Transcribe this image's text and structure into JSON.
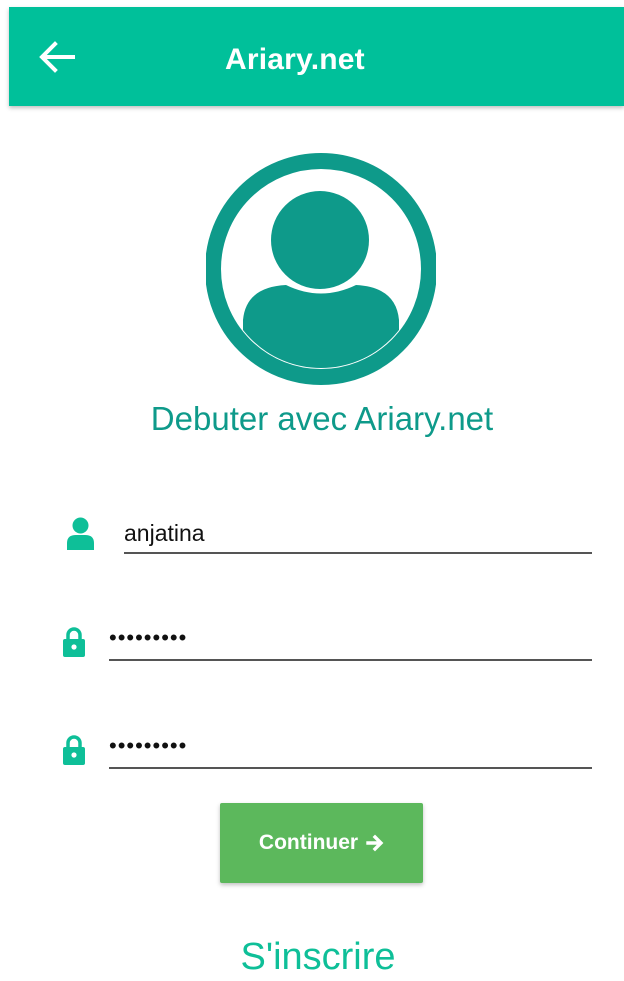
{
  "appbar": {
    "title": "Ariary.net",
    "back_icon": "arrow-left-icon",
    "background_color": "#00c09a"
  },
  "avatar": {
    "icon": "user-circle-icon",
    "color": "#0e9a8a"
  },
  "welcome_text": "Debuter avec Ariary.net",
  "form": {
    "username": {
      "icon": "user-icon",
      "value": "anjatina"
    },
    "password": {
      "icon": "lock-icon",
      "value": "•••••••••"
    },
    "confirm_password": {
      "icon": "lock-icon",
      "value": "•••••••••"
    }
  },
  "continue_button": {
    "label": "Continuer",
    "icon": "arrow-right-icon",
    "color": "#5cb85c"
  },
  "signup_link": "S'inscrire",
  "colors": {
    "primary": "#00c09a",
    "accent_text": "#0e9a8a",
    "button": "#5cb85c"
  }
}
